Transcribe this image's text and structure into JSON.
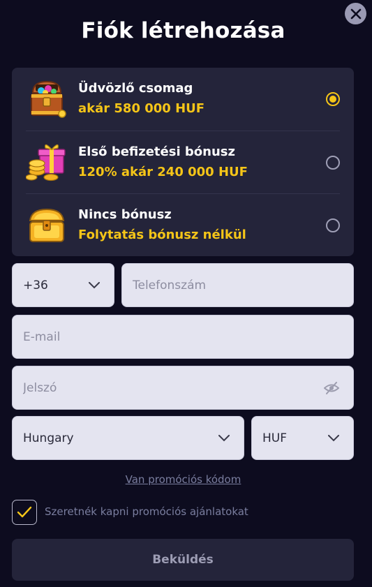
{
  "title": "Fiók létrehozása",
  "bonuses": [
    {
      "name": "Üdvözlő csomag",
      "desc": "akár 580 000 HUF",
      "selected": true
    },
    {
      "name": "Első befizetési bónusz",
      "desc": "120% akár 240 000 HUF",
      "selected": false
    },
    {
      "name": "Nincs bónusz",
      "desc": "Folytatás bónusz nélkül",
      "selected": false
    }
  ],
  "form": {
    "phone_code": "+36",
    "phone_placeholder": "Telefonszám",
    "email_placeholder": "E-mail",
    "password_placeholder": "Jelszó",
    "country": "Hungary",
    "currency": "HUF"
  },
  "promo_link": "Van promóciós kódom",
  "consent_label": "Szeretnék kapni promóciós ajánlatokat",
  "consent_checked": true,
  "submit_label": "Beküldés",
  "colors": {
    "accent": "#f5c518",
    "panel": "#24243a",
    "background": "#0d0c1f"
  }
}
